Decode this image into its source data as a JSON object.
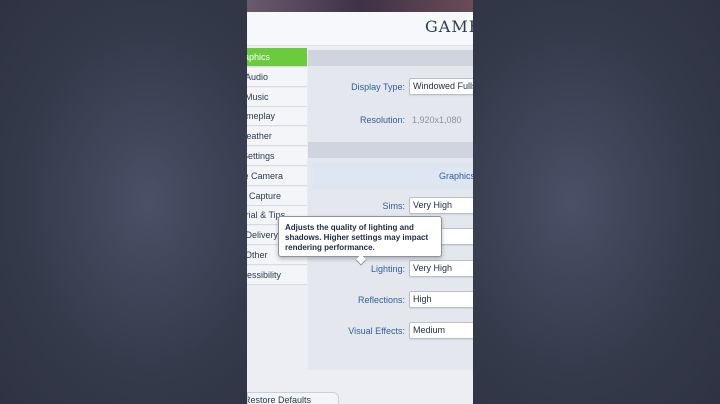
{
  "window": {
    "title": "GAME OPTIONS"
  },
  "nav": {
    "items": [
      {
        "label": "Graphics",
        "active": true
      },
      {
        "label": "Audio"
      },
      {
        "label": "Music"
      },
      {
        "label": "Gameplay"
      },
      {
        "label": "Weather"
      },
      {
        "label": "Other Settings"
      },
      {
        "label": "Free Camera"
      },
      {
        "label": "Screen Capture"
      },
      {
        "label": "Tutorial & Tips"
      },
      {
        "label": "Sims Delivery"
      },
      {
        "label": "Other"
      },
      {
        "label": "Accessibility"
      }
    ],
    "restore_label": "Restore Defaults"
  },
  "display": {
    "display_type_label": "Display Type:",
    "display_type_value": "Windowed Fullscreen",
    "resolution_label": "Resolution:",
    "resolution_value": "1,920x1,080"
  },
  "graphics": {
    "subheader": "Graphics",
    "sims_label": "Sims:",
    "sims_value": "Very High",
    "lighting_label": "Lighting:",
    "lighting_value": "Very High",
    "reflections_label": "Reflections:",
    "reflections_value": "High",
    "visual_effects_label": "Visual Effects:",
    "visual_effects_value": "Medium"
  },
  "tooltip": {
    "text": "Adjusts the quality of lighting and shadows.  Higher settings may impact rendering performance."
  },
  "colors": {
    "active_nav": "#6acb3c",
    "label_blue": "#2e5f9c",
    "panel_bg": "#eceef3"
  }
}
